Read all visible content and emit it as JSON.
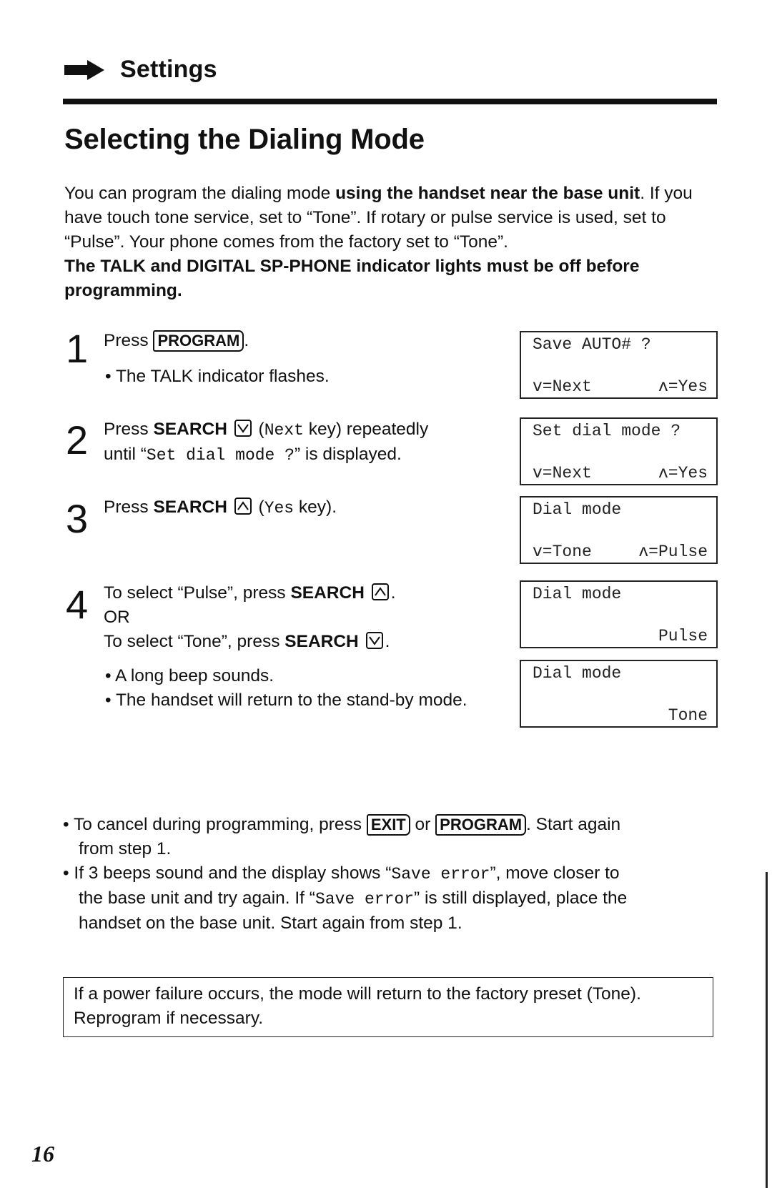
{
  "header": {
    "section": "Settings",
    "icon": "arrow-right-icon"
  },
  "title": "Selecting the Dialing Mode",
  "intro": {
    "p1_a": "You can program the dialing mode ",
    "p1_bold": "using the handset near the base unit",
    "p1_b": ". If you have touch tone service, set to “Tone”. If rotary or pulse service is used, set to “Pulse”. Your phone comes from the factory set to “Tone”.",
    "warning": "The TALK and DIGITAL SP-PHONE indicator lights must be off before programming."
  },
  "steps": [
    {
      "number": "1",
      "press": "Press ",
      "key": "PROGRAM",
      "end": ".",
      "bullets": [
        "The TALK indicator flashes."
      ]
    },
    {
      "number": "2",
      "press": "Press ",
      "search": "SEARCH",
      "paren_open": " (",
      "mono_key": "Next",
      "paren_close": " key) repeatedly",
      "until": "until “",
      "mono_display": "Set dial mode ?",
      "until_end": "” is displayed."
    },
    {
      "number": "3",
      "press": "Press ",
      "search": "SEARCH",
      "paren_open": " (",
      "mono_key": "Yes",
      "paren_close": " key)."
    },
    {
      "number": "4",
      "line1": "To select “Pulse”, press ",
      "search": "SEARCH",
      "or": "OR",
      "line3": "To select “Tone”, press ",
      "bullets": [
        "A long beep sounds.",
        "The handset will return to the stand-by mode."
      ]
    }
  ],
  "displays": [
    {
      "line1": "Save AUTO# ?",
      "line2_left": "v=Next",
      "line2_right": "ʌ=Yes"
    },
    {
      "line1": "Set dial mode ?",
      "line2_left": "v=Next",
      "line2_right": "ʌ=Yes"
    },
    {
      "line1": "Dial mode",
      "line2_left": "v=Tone",
      "line2_right": "ʌ=Pulse"
    },
    {
      "line1": "Dial mode",
      "line2_right": "Pulse"
    },
    {
      "line1": "Dial mode",
      "line2_right": "Tone"
    }
  ],
  "notes": {
    "cancel_a": "To cancel during programming, press ",
    "exit_key": "EXIT",
    "cancel_or": " or ",
    "program_key": "PROGRAM",
    "cancel_b": ". Start again",
    "cancel_c": "from step 1.",
    "error_a": "If 3 beeps sound and the display shows “",
    "error_mono": "Save error",
    "error_b": "”, move closer to",
    "error_c": "the base unit and try again. If “",
    "error_mono2": "Save error",
    "error_d": "” is still displayed, place the",
    "error_e": "handset on the base unit. Start again from step 1."
  },
  "notice": {
    "line1": "If a power failure occurs, the mode will return to the factory preset (Tone).",
    "line2": "Reprogram if necessary."
  },
  "page_number": "16",
  "bullet_char": "•"
}
